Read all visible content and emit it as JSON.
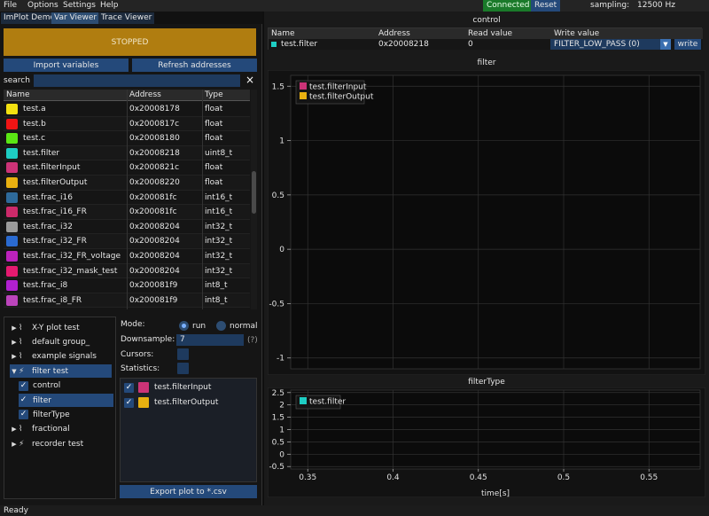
{
  "menu": {
    "file": "File",
    "options": "Options",
    "settings": "Settings",
    "help": "Help"
  },
  "status_bar": {
    "connected": "Connected",
    "reset": "Reset",
    "sampling_label": "sampling:",
    "sampling_value": "12500 Hz",
    "ready": "Ready"
  },
  "tabs": [
    "ImPlot Demo",
    "Var Viewer",
    "Trace Viewer"
  ],
  "left": {
    "state_button": "STOPPED",
    "import_button": "Import variables",
    "refresh_button": "Refresh addresses",
    "search_label": "search",
    "search_value": "",
    "clear_icon": "×"
  },
  "var_table": {
    "headers": [
      "Name",
      "Address",
      "Type"
    ],
    "rows": [
      {
        "color": "#f2e010",
        "name": "test.a",
        "address": "0x20008178",
        "type": "float"
      },
      {
        "color": "#f01414",
        "name": "test.b",
        "address": "0x2000817c",
        "type": "float"
      },
      {
        "color": "#5ae614",
        "name": "test.c",
        "address": "0x20008180",
        "type": "float"
      },
      {
        "color": "#1ecdc3",
        "name": "test.filter",
        "address": "0x20008218",
        "type": "uint8_t"
      },
      {
        "color": "#cc3377",
        "name": "test.filterInput",
        "address": "0x2000821c",
        "type": "float"
      },
      {
        "color": "#e8b010",
        "name": "test.filterOutput",
        "address": "0x20008220",
        "type": "float"
      },
      {
        "color": "#2e6a9a",
        "name": "test.frac_i16",
        "address": "0x200081fc",
        "type": "int16_t"
      },
      {
        "color": "#cc2a6a",
        "name": "test.frac_i16_FR",
        "address": "0x200081fc",
        "type": "int16_t"
      },
      {
        "color": "#9a9a9a",
        "name": "test.frac_i32",
        "address": "0x20008204",
        "type": "int32_t"
      },
      {
        "color": "#2a6ad0",
        "name": "test.frac_i32_FR",
        "address": "0x20008204",
        "type": "int32_t"
      },
      {
        "color": "#bb22bb",
        "name": "test.frac_i32_FR_voltage",
        "address": "0x20008204",
        "type": "int32_t"
      },
      {
        "color": "#e41a70",
        "name": "test.frac_i32_mask_test",
        "address": "0x20008204",
        "type": "int32_t"
      },
      {
        "color": "#b020d0",
        "name": "test.frac_i8",
        "address": "0x200081f9",
        "type": "int8_t"
      },
      {
        "color": "#bb44bb",
        "name": "test.frac_i8_FR",
        "address": "0x200081f9",
        "type": "int8_t"
      }
    ]
  },
  "tree": {
    "items": [
      {
        "label": "X-Y plot test",
        "level": 0,
        "arrow": "▶",
        "icon": "⌇",
        "selected": false,
        "checked": false
      },
      {
        "label": "default group_",
        "level": 0,
        "arrow": "▶",
        "icon": "⌇",
        "selected": false,
        "checked": false
      },
      {
        "label": "example signals",
        "level": 0,
        "arrow": "▶",
        "icon": "⌇",
        "selected": false,
        "checked": false
      },
      {
        "label": "filter test",
        "level": 0,
        "arrow": "▼",
        "icon": "⚡",
        "selected": true,
        "checked": false
      },
      {
        "label": "control",
        "level": 1,
        "arrow": "",
        "icon": "",
        "selected": false,
        "checked": true
      },
      {
        "label": "filter",
        "level": 1,
        "arrow": "",
        "icon": "",
        "selected": true,
        "checked": true
      },
      {
        "label": "filterType",
        "level": 1,
        "arrow": "",
        "icon": "",
        "selected": false,
        "checked": true
      },
      {
        "label": "fractional",
        "level": 0,
        "arrow": "▶",
        "icon": "⌇",
        "selected": false,
        "checked": false
      },
      {
        "label": "recorder test",
        "level": 0,
        "arrow": "▶",
        "icon": "⚡",
        "selected": false,
        "checked": false
      }
    ]
  },
  "options": {
    "mode_label": "Mode:",
    "mode_run": "run",
    "mode_normal": "normal",
    "mode_selected": "run",
    "downsample_label": "Downsample:",
    "downsample_value": "7",
    "help_icon": "(?)",
    "cursors_label": "Cursors:",
    "statistics_label": "Statistics:",
    "signals": [
      {
        "name": "test.filterInput",
        "color": "#cc3377"
      },
      {
        "name": "test.filterOutput",
        "color": "#e8b010"
      }
    ],
    "export_button": "Export plot to *.csv"
  },
  "control": {
    "title": "control",
    "headers": [
      "Name",
      "Address",
      "Read value",
      "Write value"
    ],
    "row": {
      "color": "#1ecdc3",
      "name": "test.filter",
      "address": "0x20008218",
      "read_value": "0",
      "write_value": "FILTER_LOW_PASS (0)",
      "write_button": "write"
    }
  },
  "chart_data": [
    {
      "type": "line",
      "title": "filter",
      "series": [
        {
          "name": "test.filterInput",
          "color": "#cc3377",
          "values": []
        },
        {
          "name": "test.filterOutput",
          "color": "#e8b010",
          "values": []
        }
      ],
      "y_ticks": [
        "1.5",
        "1",
        "0.5",
        "0",
        "-0.5",
        "-1"
      ],
      "ylim": [
        -1.1,
        1.6
      ],
      "xlim": [
        0.34,
        0.58
      ],
      "grid": true,
      "legend": "top-left"
    },
    {
      "type": "line",
      "title": "filterType",
      "series": [
        {
          "name": "test.filter",
          "color": "#1ecdc3",
          "values": []
        }
      ],
      "y_ticks": [
        "2.5",
        "2",
        "1.5",
        "1",
        "0.5",
        "0",
        "-0.5"
      ],
      "x_ticks": [
        "0.35",
        "0.4",
        "0.45",
        "0.5",
        "0.55"
      ],
      "xlabel": "time[s]",
      "ylim": [
        -0.6,
        2.6
      ],
      "xlim": [
        0.34,
        0.58
      ],
      "grid": true,
      "legend": "top-left"
    }
  ]
}
